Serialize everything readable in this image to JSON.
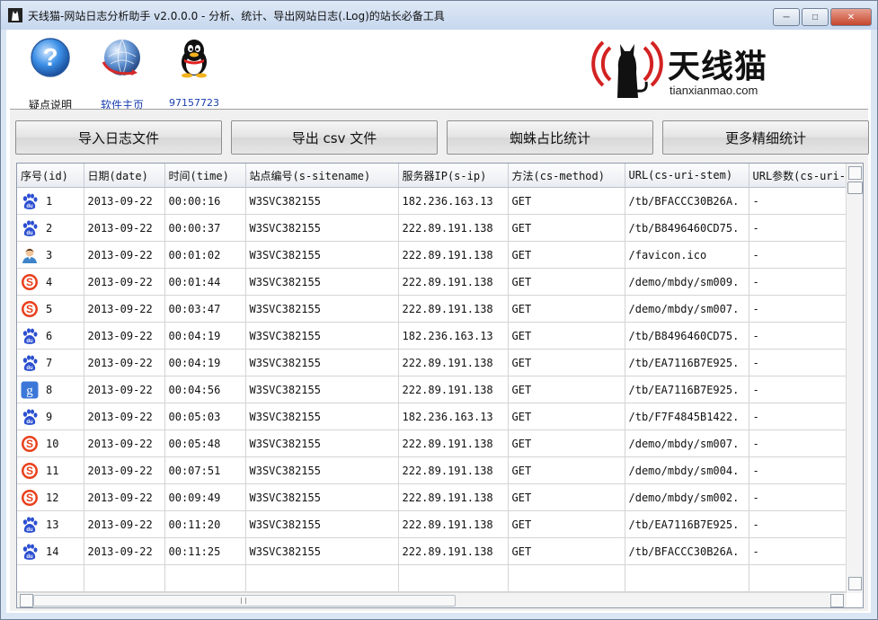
{
  "window": {
    "title": "天线猫-网站日志分析助手 v2.0.0.0 - 分析、统计、导出网站日志(.Log)的站长必备工具"
  },
  "toolbar": {
    "help_label": "疑点说明",
    "home_label": "软件主页",
    "qq_label": "97157723"
  },
  "logo": {
    "brand": "天线猫",
    "url": "tianxianmao.com"
  },
  "buttons": {
    "import": "导入日志文件",
    "export": "导出 csv 文件",
    "spider": "蜘蛛占比统计",
    "more": "更多精细统计"
  },
  "table": {
    "columns": [
      "序号(id)",
      "日期(date)",
      "时间(time)",
      "站点编号(s-sitename)",
      "服务器IP(s-ip)",
      "方法(cs-method)",
      "URL(cs-uri-stem)",
      "URL参数(cs-uri-q"
    ],
    "rows": [
      {
        "icon": "baidu-icon",
        "id": "1",
        "date": "2013-09-22",
        "time": "00:00:16",
        "site": "W3SVC382155",
        "ip": "182.236.163.13",
        "method": "GET",
        "uri": "/tb/BFACCC30B26A.",
        "query": "-"
      },
      {
        "icon": "baidu-icon",
        "id": "2",
        "date": "2013-09-22",
        "time": "00:00:37",
        "site": "W3SVC382155",
        "ip": "222.89.191.138",
        "method": "GET",
        "uri": "/tb/B8496460CD75.",
        "query": "-"
      },
      {
        "icon": "user-icon",
        "id": "3",
        "date": "2013-09-22",
        "time": "00:01:02",
        "site": "W3SVC382155",
        "ip": "222.89.191.138",
        "method": "GET",
        "uri": "/favicon.ico",
        "query": "-"
      },
      {
        "icon": "sogou-icon",
        "id": "4",
        "date": "2013-09-22",
        "time": "00:01:44",
        "site": "W3SVC382155",
        "ip": "222.89.191.138",
        "method": "GET",
        "uri": "/demo/mbdy/sm009.",
        "query": "-"
      },
      {
        "icon": "sogou-icon",
        "id": "5",
        "date": "2013-09-22",
        "time": "00:03:47",
        "site": "W3SVC382155",
        "ip": "222.89.191.138",
        "method": "GET",
        "uri": "/demo/mbdy/sm007.",
        "query": "-"
      },
      {
        "icon": "baidu-icon",
        "id": "6",
        "date": "2013-09-22",
        "time": "00:04:19",
        "site": "W3SVC382155",
        "ip": "182.236.163.13",
        "method": "GET",
        "uri": "/tb/B8496460CD75.",
        "query": "-"
      },
      {
        "icon": "baidu-icon",
        "id": "7",
        "date": "2013-09-22",
        "time": "00:04:19",
        "site": "W3SVC382155",
        "ip": "222.89.191.138",
        "method": "GET",
        "uri": "/tb/EA7116B7E925.",
        "query": "-"
      },
      {
        "icon": "google-icon",
        "id": "8",
        "date": "2013-09-22",
        "time": "00:04:56",
        "site": "W3SVC382155",
        "ip": "222.89.191.138",
        "method": "GET",
        "uri": "/tb/EA7116B7E925.",
        "query": "-"
      },
      {
        "icon": "baidu-icon",
        "id": "9",
        "date": "2013-09-22",
        "time": "00:05:03",
        "site": "W3SVC382155",
        "ip": "182.236.163.13",
        "method": "GET",
        "uri": "/tb/F7F4845B1422.",
        "query": "-"
      },
      {
        "icon": "sogou-icon",
        "id": "10",
        "date": "2013-09-22",
        "time": "00:05:48",
        "site": "W3SVC382155",
        "ip": "222.89.191.138",
        "method": "GET",
        "uri": "/demo/mbdy/sm007.",
        "query": "-"
      },
      {
        "icon": "sogou-icon",
        "id": "11",
        "date": "2013-09-22",
        "time": "00:07:51",
        "site": "W3SVC382155",
        "ip": "222.89.191.138",
        "method": "GET",
        "uri": "/demo/mbdy/sm004.",
        "query": "-"
      },
      {
        "icon": "sogou-icon",
        "id": "12",
        "date": "2013-09-22",
        "time": "00:09:49",
        "site": "W3SVC382155",
        "ip": "222.89.191.138",
        "method": "GET",
        "uri": "/demo/mbdy/sm002.",
        "query": "-"
      },
      {
        "icon": "baidu-icon",
        "id": "13",
        "date": "2013-09-22",
        "time": "00:11:20",
        "site": "W3SVC382155",
        "ip": "222.89.191.138",
        "method": "GET",
        "uri": "/tb/EA7116B7E925.",
        "query": "-"
      },
      {
        "icon": "baidu-icon",
        "id": "14",
        "date": "2013-09-22",
        "time": "00:11:25",
        "site": "W3SVC382155",
        "ip": "222.89.191.138",
        "method": "GET",
        "uri": "/tb/BFACCC30B26A.",
        "query": "-"
      }
    ]
  },
  "colors": {
    "baidu": "#2b4fd1",
    "sogou": "#e8401c",
    "google": "#3b77d8",
    "logo_red": "#d32222"
  }
}
